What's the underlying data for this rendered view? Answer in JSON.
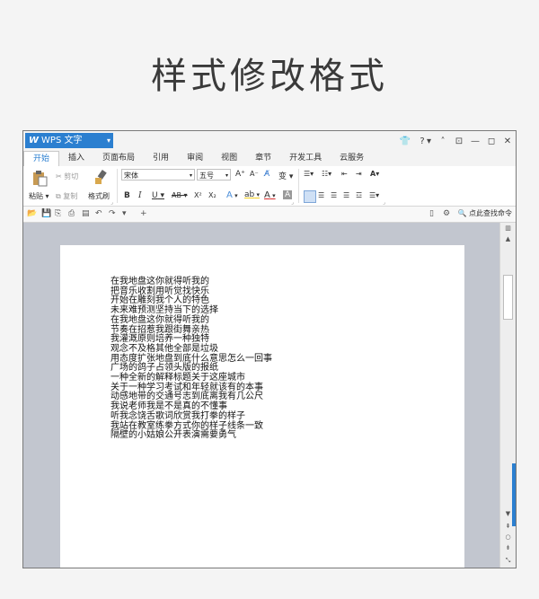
{
  "heading": "样式修改格式",
  "app": {
    "name": "WPS 文字",
    "logo": "W"
  },
  "titlebar_icons": [
    "shirt-icon",
    "help-icon",
    "pin-icon",
    "minimize-icon",
    "restore-icon",
    "close-icon"
  ],
  "titlebar": {
    "help": "?"
  },
  "tabs": [
    "开始",
    "插入",
    "页面布局",
    "引用",
    "审阅",
    "视图",
    "章节",
    "开发工具",
    "云服务"
  ],
  "ribbon": {
    "paste": "粘贴",
    "cut": "剪切",
    "copy": "复制",
    "format_painter": "格式刷",
    "font_name": "宋体",
    "font_size": "五号",
    "bold": "B",
    "italic": "I",
    "underline": "U",
    "strike": "AB",
    "superscript": "X²",
    "subscript": "X₂",
    "grow": "A⁺",
    "shrink": "A⁻",
    "text_effect": "A",
    "highlight": "ab",
    "font_color": "A",
    "char_shade": "A"
  },
  "quickbar": {
    "search": "点此查找命令"
  },
  "document": {
    "lines": [
      "在我地盘这你就得听我的",
      "把音乐收割用听觉找快乐",
      "开始在雕刻我个人的特色",
      "未来难预测坚持当下的选择",
      "在我地盘这你就得听我的",
      "节奏在招惹我跟街舞亲热",
      "我灌溉原则培养一种独特",
      "观念不及格其他全部是垃圾",
      "用态度扩张地盘到底什么意思怎么一回事",
      "广场的鸽子占领头版的报纸",
      "一种全新的解释标题关于这座城市",
      "关于一种学习考试和年轻就该有的本事",
      "动感地带的交通号志到底离我有几公尺",
      "我说老师我是不是真的不懂事",
      "听我念饶舌歌词欣赏我打拳的样子",
      "我站在教室练拳方式你的样子线条一致",
      "隔壁的小姑娘公开表演需要勇气"
    ]
  },
  "colors": {
    "accent": "#2b7fd0",
    "doc_bg": "#c2c6cf"
  }
}
